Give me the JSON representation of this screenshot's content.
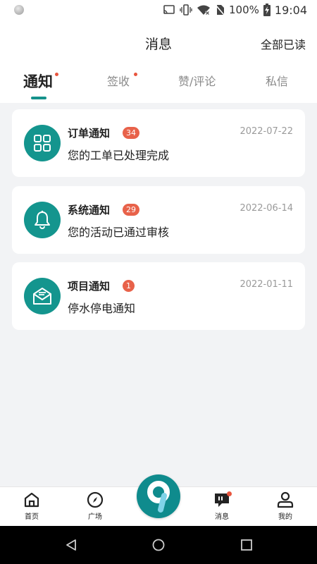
{
  "status_bar": {
    "battery": "100%",
    "time": "19:04"
  },
  "header": {
    "title": "消息",
    "mark_all_read": "全部已读"
  },
  "tabs": [
    {
      "label": "通知",
      "active": true,
      "has_dot": true
    },
    {
      "label": "签收",
      "active": false,
      "has_dot": true
    },
    {
      "label": "赞/评论",
      "active": false,
      "has_dot": false
    },
    {
      "label": "私信",
      "active": false,
      "has_dot": false
    }
  ],
  "notifications": [
    {
      "title": "订单通知",
      "badge": "34",
      "date": "2022-07-22",
      "body": "您的工单已处理完成",
      "icon": "grid-icon"
    },
    {
      "title": "系统通知",
      "badge": "29",
      "date": "2022-06-14",
      "body": "您的活动已通过审核",
      "icon": "bell-icon"
    },
    {
      "title": "项目通知",
      "badge": "1",
      "date": "2022-01-11",
      "body": "停水停电通知",
      "icon": "mail-open-icon"
    }
  ],
  "bottom_nav": [
    {
      "label": "首页",
      "icon": "home-icon"
    },
    {
      "label": "广场",
      "icon": "compass-icon"
    },
    {
      "label": "消息",
      "icon": "message-icon",
      "has_dot": true
    },
    {
      "label": "我的",
      "icon": "user-icon"
    }
  ],
  "center_button": {
    "icon": "app-logo-9-icon"
  },
  "colors": {
    "accent": "#14958e",
    "badge": "#e8624a",
    "dot": "#e8553e",
    "background": "#f2f3f5"
  }
}
